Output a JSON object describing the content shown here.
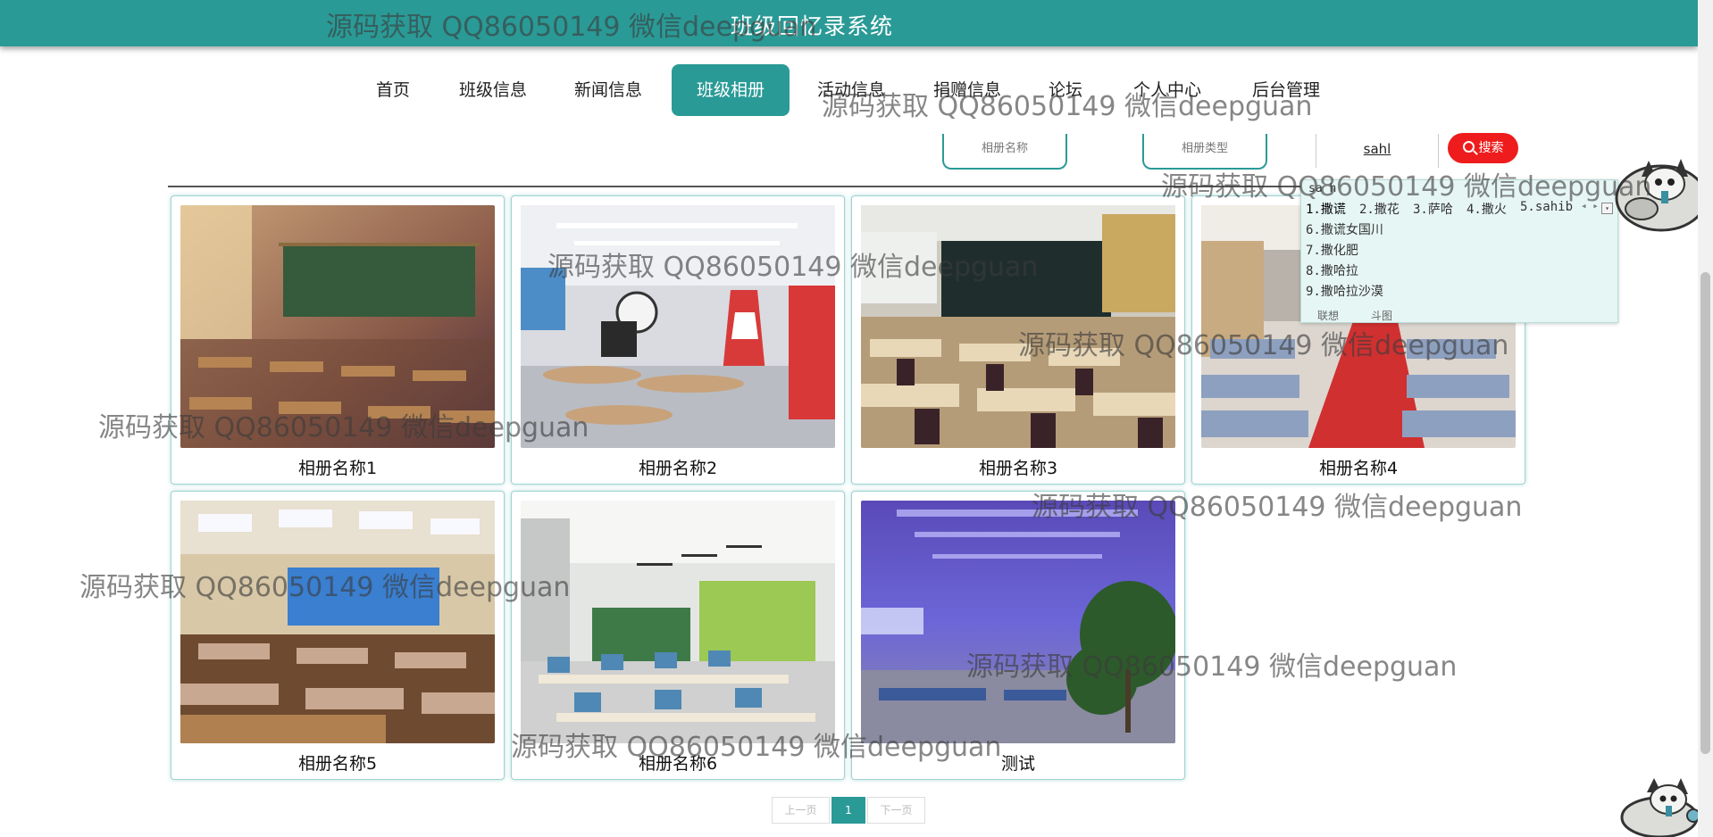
{
  "header": {
    "title": "班级回忆录系统"
  },
  "nav": {
    "items": [
      {
        "label": "首页",
        "active": false
      },
      {
        "label": "班级信息",
        "active": false
      },
      {
        "label": "新闻信息",
        "active": false
      },
      {
        "label": "班级相册",
        "active": true
      },
      {
        "label": "活动信息",
        "active": false
      },
      {
        "label": "捐赠信息",
        "active": false
      },
      {
        "label": "论坛",
        "active": false
      },
      {
        "label": "个人中心",
        "active": false
      },
      {
        "label": "后台管理",
        "active": false
      }
    ]
  },
  "search": {
    "album_name_placeholder": "相册名称",
    "album_type_placeholder": "相册类型",
    "ime_text": "sahl",
    "button_label": "搜索"
  },
  "ime": {
    "composition": "sa h",
    "candidates": [
      "1.撒谎",
      "2.撒花",
      "3.萨哈",
      "4.撒火",
      "5.sahib",
      "6.撒谎女国川",
      "7.撒化肥",
      "8.撒哈拉",
      "9.撒哈拉沙漠"
    ],
    "arrows": "◂ ▸",
    "footer": [
      "联想",
      "斗图"
    ]
  },
  "albums": [
    {
      "name": "相册名称1",
      "scene": "classroom-green-board"
    },
    {
      "name": "相册名称2",
      "scene": "modern-classroom-red-stripes"
    },
    {
      "name": "相册名称3",
      "scene": "lecture-hall-blackboard"
    },
    {
      "name": "相册名称4",
      "scene": "classroom-red-carpet"
    },
    {
      "name": "相册名称5",
      "scene": "conference-room-video-wall"
    },
    {
      "name": "相册名称6",
      "scene": "bright-classroom-green-wall"
    },
    {
      "name": "测试",
      "scene": "station-hall-blue-light"
    }
  ],
  "pagination": {
    "prev": "上一页",
    "current": "1",
    "next": "下一页"
  },
  "watermark": "源码获取 QQ86050149 微信deepguan",
  "colors": {
    "primary": "#2a9a96",
    "search_button": "#ee1c1c",
    "ime_bg": "#e6f6f4"
  }
}
